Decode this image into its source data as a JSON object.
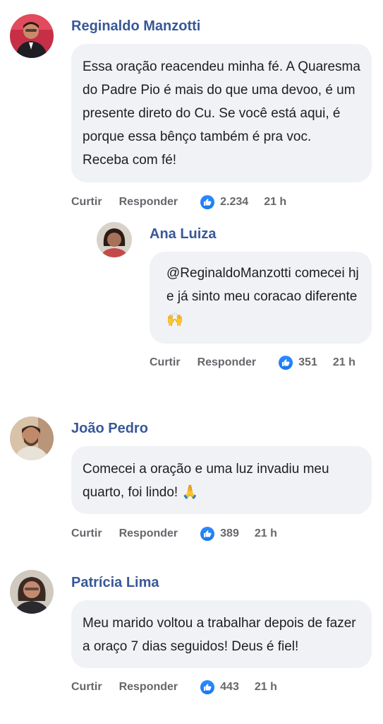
{
  "comments": [
    {
      "author": "Reginaldo Manzotti",
      "text": "Essa oração reacendeu minha fé. A Quaresma do Padre Pio é mais do que uma devoo, é um presente direto do Cu. Se você está aqui, é porque essa bênço também é pra voc. Receba com fé!",
      "like_label": "Curtir",
      "reply_label": "Responder",
      "likes": "2.234",
      "time": "21 h",
      "replies": [
        {
          "author": "Ana Luiza",
          "text": "@ReginaldoManzotti comecei hj e já sinto meu coracao diferente 🙌",
          "like_label": "Curtir",
          "reply_label": "Responder",
          "likes": "351",
          "time": "21 h"
        }
      ]
    },
    {
      "author": "João Pedro",
      "text": "Comecei a oração e uma luz invadiu meu quarto, foi lindo! 🙏",
      "like_label": "Curtir",
      "reply_label": "Responder",
      "likes": "389",
      "time": "21 h"
    },
    {
      "author": "Patrícia Lima",
      "text": "Meu marido voltou a trabalhar depois de fazer a oraço 7 dias seguidos! Deus é fiel!",
      "like_label": "Curtir",
      "reply_label": "Responder",
      "likes": "443",
      "time": "21 h"
    }
  ],
  "icons": {
    "like": "thumbs-up-icon"
  },
  "colors": {
    "author": "#385898",
    "bubble": "#f0f2f5",
    "like_badge": "#1877f2",
    "meta": "#65676b"
  }
}
